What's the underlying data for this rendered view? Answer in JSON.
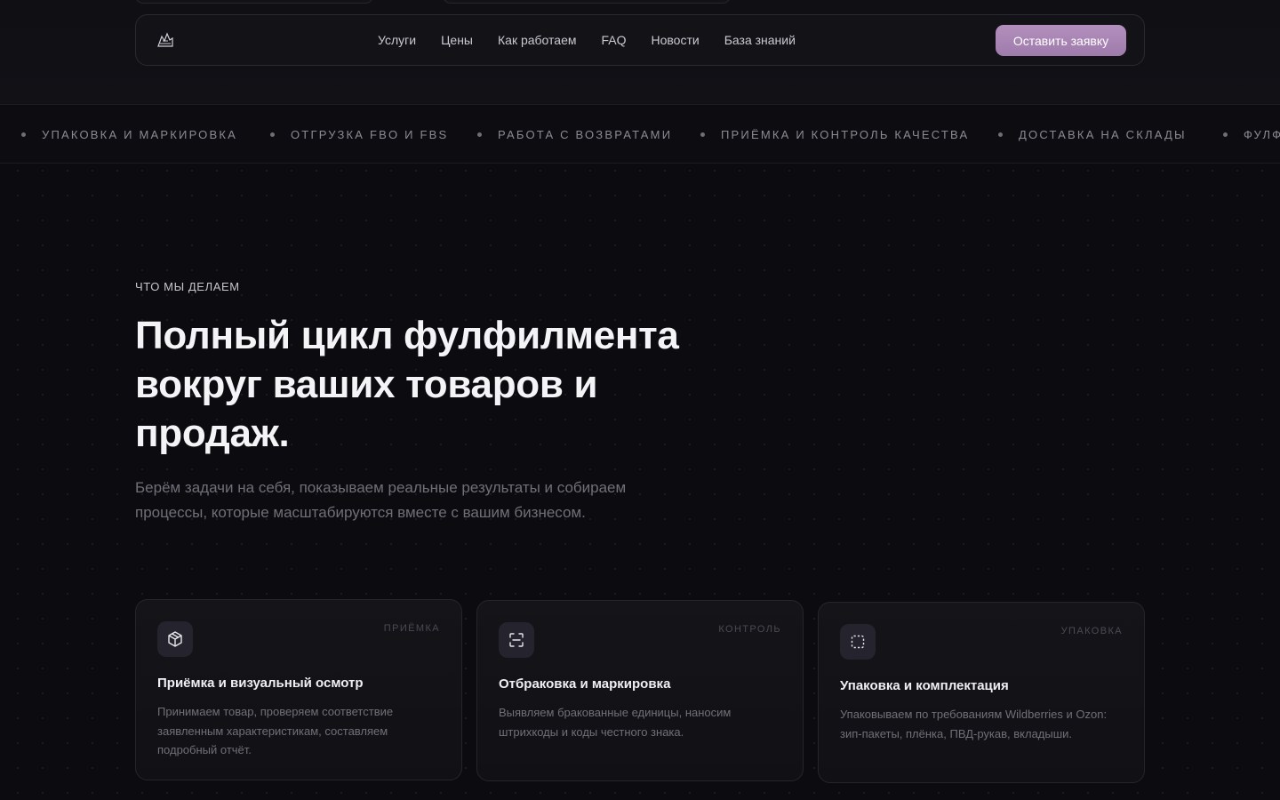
{
  "nav": {
    "links": [
      "Услуги",
      "Цены",
      "Как работаем",
      "FAQ",
      "Новости",
      "База знаний"
    ],
    "cta": "Оставить заявку"
  },
  "ticker": {
    "items": [
      "УПАКОВКА И МАРКИРОВКА",
      "ОТГРУЗКА FBO И FBS",
      "РАБОТА С ВОЗВРАТАМИ",
      "ПРИЁМКА И КОНТРОЛЬ КАЧЕСТВА",
      "ДОСТАВКА НА СКЛАДЫ",
      "ФУЛФ"
    ]
  },
  "hero": {
    "eyebrow": "ЧТО МЫ ДЕЛАЕМ",
    "title": "Полный цикл фулфилмента вокруг ваших товаров и продаж.",
    "lead": "Берём задачи на себя, показываем реальные результаты и собираем процессы, которые масштабируются вместе с вашим бизнесом."
  },
  "cards": [
    {
      "tag": "ПРИЁМКА",
      "icon": "box-icon",
      "title": "Приёмка и визуальный осмотр",
      "desc": "Принимаем товар, проверяем соответствие заявленным характеристикам, составляем подробный отчёт."
    },
    {
      "tag": "КОНТРОЛЬ",
      "icon": "scan-icon",
      "title": "Отбраковка и маркировка",
      "desc": "Выявляем бракованные единицы, наносим штрихкоды и коды честного знака."
    },
    {
      "tag": "УПАКОВКА",
      "icon": "package-frame-icon",
      "title": "Упаковка и комплектация",
      "desc": "Упаковываем по требованиям Wildberries и Ozon: зип-пакеты, плёнка, ПВД-рукав, вкладыши."
    }
  ],
  "colors": {
    "background": "#0c0c10",
    "accent": "#a884b4",
    "text_muted": "#6f6f78"
  }
}
